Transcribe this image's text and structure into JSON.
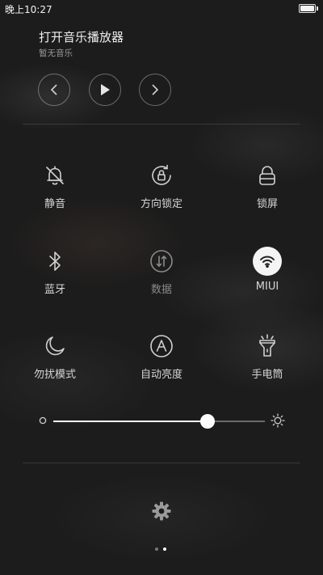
{
  "status_bar": {
    "time": "晚上10:27",
    "battery_level": 1.0
  },
  "music": {
    "title": "打开音乐播放器",
    "subtitle": "暂无音乐",
    "controls": [
      "previous-icon",
      "play-icon",
      "next-icon"
    ]
  },
  "toggles": [
    {
      "label": "静音",
      "icon": "bell-off-icon",
      "enabled": true
    },
    {
      "label": "方向锁定",
      "icon": "rotation-lock-icon",
      "enabled": true
    },
    {
      "label": "锁屏",
      "icon": "lock-icon",
      "enabled": true
    },
    {
      "label": "蓝牙",
      "icon": "bluetooth-icon",
      "enabled": true
    },
    {
      "label": "数据",
      "icon": "mobile-data-icon",
      "enabled": false
    },
    {
      "label": "MIUI",
      "icon": "wifi-icon",
      "enabled": true,
      "active": true
    },
    {
      "label": "勿扰模式",
      "icon": "moon-icon",
      "enabled": true
    },
    {
      "label": "自动亮度",
      "icon": "auto-brightness-icon",
      "enabled": true
    },
    {
      "label": "手电筒",
      "icon": "flashlight-icon",
      "enabled": true
    }
  ],
  "brightness": {
    "level": 0.73
  },
  "pager": {
    "pages": 2,
    "current": 2
  },
  "colors": {
    "background": "#1c1c1c",
    "text": "#d6d6d6",
    "dim_text": "#8a8a8a",
    "active_toggle": "#f4f4f4"
  }
}
